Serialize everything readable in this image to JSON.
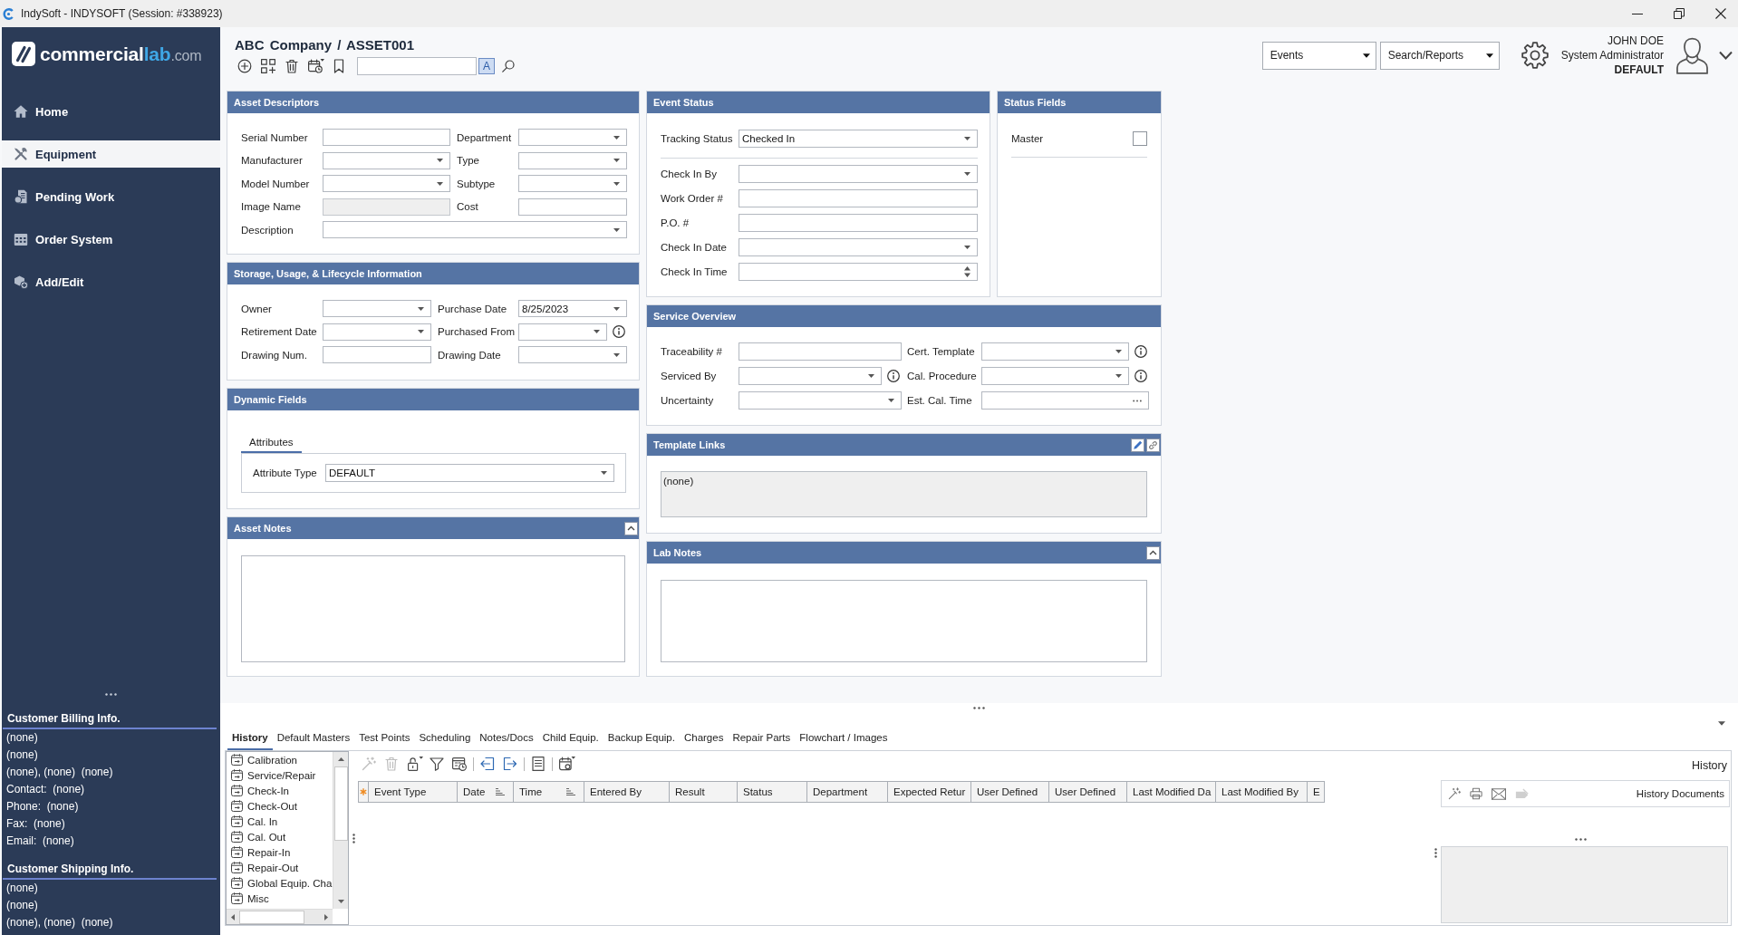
{
  "window": {
    "title": "IndySoft - INDYSOFT (Session: #338923)"
  },
  "sidebar": {
    "logo": {
      "name": "commercial",
      "accent": "lab",
      "domain": ".com"
    },
    "nav": [
      {
        "label": "Home",
        "selected": false
      },
      {
        "label": "Equipment",
        "selected": true
      },
      {
        "label": "Pending Work",
        "selected": false
      },
      {
        "label": "Order System",
        "selected": false
      },
      {
        "label": "Add/Edit",
        "selected": false
      }
    ],
    "info_sections": [
      {
        "title": "Customer Billing Info.",
        "lines": [
          "(none)",
          "(none)",
          "(none), (none)  (none)",
          "Contact:  (none)",
          "Phone:  (none)",
          "Fax:  (none)",
          "Email:  (none)"
        ]
      },
      {
        "title": "Customer Shipping Info.",
        "lines": [
          "(none)",
          "(none)",
          "(none), (none)  (none)"
        ]
      }
    ]
  },
  "header": {
    "breadcrumb": "ABC Company / ASSET001",
    "match_case": {
      "label": "A",
      "on": true
    },
    "menus": [
      "Events",
      "Search/Reports"
    ],
    "user": {
      "name": "JOHN DOE",
      "role": "System Administrator",
      "profile": "DEFAULT"
    }
  },
  "asset_descriptors": {
    "title": "Asset Descriptors",
    "fields": [
      {
        "label": "Serial Number",
        "kind": "text"
      },
      {
        "label": "Department",
        "kind": "dropdown"
      },
      {
        "label": "Manufacturer",
        "kind": "dropdown"
      },
      {
        "label": "Type",
        "kind": "dropdown"
      },
      {
        "label": "Model Number",
        "kind": "dropdown"
      },
      {
        "label": "Subtype",
        "kind": "dropdown"
      },
      {
        "label": "Image Name",
        "kind": "readonly"
      },
      {
        "label": "Cost",
        "kind": "text"
      }
    ],
    "description": {
      "label": "Description",
      "kind": "dropdown"
    }
  },
  "storage": {
    "title": "Storage, Usage, & Lifecycle Information",
    "fields": [
      {
        "label": "Owner",
        "kind": "dropdown"
      },
      {
        "label": "Purchase Date",
        "kind": "dropdown",
        "value": "8/25/2023"
      },
      {
        "label": "Retirement Date",
        "kind": "dropdown"
      },
      {
        "label": "Purchased From",
        "kind": "dropdown",
        "info": true
      },
      {
        "label": "Drawing Num.",
        "kind": "text"
      },
      {
        "label": "Drawing Date",
        "kind": "dropdown"
      }
    ]
  },
  "dynamic_fields": {
    "title": "Dynamic Fields",
    "tabs": [
      {
        "label": "Attributes",
        "selected": true
      }
    ],
    "fields": [
      {
        "label": "Attribute Type",
        "kind": "dropdown",
        "value": "DEFAULT"
      }
    ]
  },
  "asset_notes": {
    "title": "Asset Notes",
    "collapsible": true
  },
  "event_status": {
    "title": "Event Status",
    "primary": {
      "label": "Tracking Status",
      "kind": "dropdown",
      "value": "Checked In"
    },
    "fields": [
      {
        "label": "Check In By",
        "kind": "dropdown"
      },
      {
        "label": "Work Order #",
        "kind": "text"
      },
      {
        "label": "P.O. #",
        "kind": "text"
      },
      {
        "label": "Check In Date",
        "kind": "dropdown"
      },
      {
        "label": "Check In Time",
        "kind": "spin"
      }
    ]
  },
  "status_fields": {
    "title": "Status Fields",
    "fields": [
      {
        "label": "Master",
        "kind": "checkbox",
        "checked": false
      }
    ]
  },
  "service_overview": {
    "title": "Service Overview",
    "fields": [
      {
        "label": "Traceability #",
        "kind": "text"
      },
      {
        "label": "Cert. Template",
        "kind": "dropdown",
        "info": true
      },
      {
        "label": "Serviced By",
        "kind": "dropdown",
        "info": true
      },
      {
        "label": "Cal. Procedure",
        "kind": "dropdown",
        "info": true
      },
      {
        "label": "Uncertainty",
        "kind": "dropdown"
      },
      {
        "label": "Est. Cal. Time",
        "kind": "ellipsis"
      }
    ]
  },
  "template_links": {
    "title": "Template Links",
    "value": "(none)"
  },
  "lab_notes": {
    "title": "Lab Notes",
    "collapsible": true
  },
  "bottom": {
    "tabs": [
      {
        "label": "History",
        "selected": true
      },
      {
        "label": "Default Masters",
        "selected": false
      },
      {
        "label": "Test Points",
        "selected": false
      },
      {
        "label": "Scheduling",
        "selected": false
      },
      {
        "label": "Notes/Docs",
        "selected": false
      },
      {
        "label": "Child Equip.",
        "selected": false
      },
      {
        "label": "Backup Equip.",
        "selected": false
      },
      {
        "label": "Charges",
        "selected": false
      },
      {
        "label": "Repair Parts",
        "selected": false
      },
      {
        "label": "Flowchart / Images",
        "selected": false
      }
    ],
    "event_types": [
      {
        "label": "Calibration",
        "selected": false
      },
      {
        "label": "Service/Repair",
        "selected": false
      },
      {
        "label": "Check-In",
        "selected": false
      },
      {
        "label": "Check-Out",
        "selected": false
      },
      {
        "label": "Cal. In",
        "selected": false
      },
      {
        "label": "Cal. Out",
        "selected": false
      },
      {
        "label": "Repair-In",
        "selected": false
      },
      {
        "label": "Repair-Out",
        "selected": false
      },
      {
        "label": "Global Equip. Cha",
        "selected": false
      },
      {
        "label": "Misc",
        "selected": false
      }
    ],
    "toolbar": [
      {
        "disabled": true
      },
      {
        "disabled": true
      },
      {
        "disabled": false
      },
      {
        "disabled": false
      },
      {
        "disabled": false
      },
      {
        "disabled": false
      },
      {
        "disabled": false
      },
      {
        "disabled": false
      },
      {
        "disabled": false
      }
    ],
    "columns": [
      {
        "label": "Event Type",
        "sortable": false
      },
      {
        "label": "Date",
        "sortable": true
      },
      {
        "label": "Time",
        "sortable": true
      },
      {
        "label": "Entered By",
        "sortable": false
      },
      {
        "label": "Result",
        "sortable": false
      },
      {
        "label": "Status",
        "sortable": false
      },
      {
        "label": "Department",
        "sortable": false
      },
      {
        "label": "Expected Retur",
        "sortable": false
      },
      {
        "label": "User Defined",
        "sortable": false
      },
      {
        "label": "User Defined",
        "sortable": false
      },
      {
        "label": "Last Modified Da",
        "sortable": false
      },
      {
        "label": "Last Modified By",
        "sortable": false
      },
      {
        "label": "E",
        "sortable": false
      }
    ],
    "history": {
      "title": "History",
      "documents": {
        "label": "History Documents",
        "tools": [
          {
            "disabled": false
          },
          {
            "disabled": false
          },
          {
            "disabled": false
          },
          {
            "disabled": true
          }
        ]
      }
    }
  }
}
